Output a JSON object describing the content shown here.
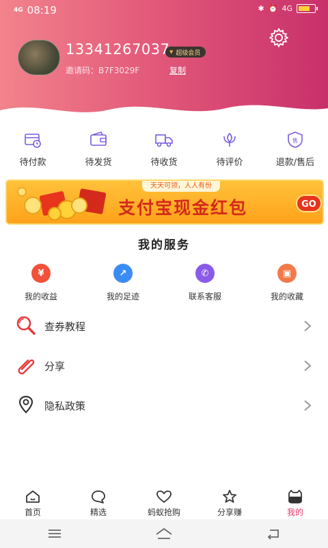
{
  "status_bar": {
    "network": "4G",
    "time": "08:19",
    "net_right": "4G"
  },
  "profile": {
    "phone": "13341267037",
    "vip_label": "超级会员",
    "invite_code": "邀请码：B7F3029F",
    "copy_label": "复制"
  },
  "orders": [
    {
      "label": "待付款",
      "icon": "wallet-clock-icon"
    },
    {
      "label": "待发货",
      "icon": "wallet-icon"
    },
    {
      "label": "待收货",
      "icon": "truck-icon"
    },
    {
      "label": "待评价",
      "icon": "flower-icon"
    },
    {
      "label": "退款/售后",
      "icon": "shield-refund-icon"
    }
  ],
  "banner": {
    "pill": "天天可领，人人有份",
    "title": "支付宝现金红包",
    "go": "GO"
  },
  "services": {
    "title": "我的服务",
    "items": [
      {
        "label": "我的收益",
        "glyph": "¥",
        "color": "#f2503a"
      },
      {
        "label": "我的足迹",
        "glyph": "↗",
        "color": "#3a8cf2"
      },
      {
        "label": "联系客服",
        "glyph": "✆",
        "color": "#8a5ae8"
      },
      {
        "label": "我的收藏",
        "glyph": "▣",
        "color": "#f27a4a"
      }
    ]
  },
  "menu": [
    {
      "label": "查券教程",
      "icon": "magnifier-icon"
    },
    {
      "label": "分享",
      "icon": "paperclip-icon"
    },
    {
      "label": "隐私政策",
      "icon": "location-pin-icon"
    }
  ],
  "tabs": [
    {
      "label": "首页",
      "icon": "home-icon"
    },
    {
      "label": "精选",
      "icon": "chat-bubble-icon"
    },
    {
      "label": "蚂蚁抢购",
      "icon": "heart-icon"
    },
    {
      "label": "分享赚",
      "icon": "star-icon"
    },
    {
      "label": "我的",
      "icon": "profile-face-icon",
      "active": true
    }
  ],
  "colors": {
    "accent": "#e8386a",
    "header_start": "#f2838c",
    "header_end": "#c8306a",
    "icon_purple": "#7a5ae0"
  }
}
